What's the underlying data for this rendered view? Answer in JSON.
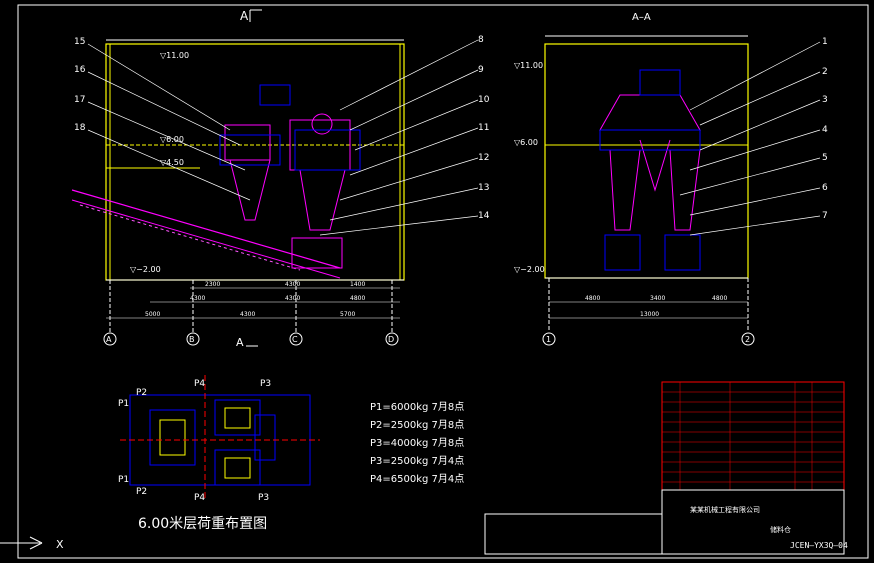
{
  "views": {
    "left_section_mark": "A",
    "left_section_mark_bottom": "A",
    "right_title": "A–A"
  },
  "elevations": {
    "left_top": "▽11.00",
    "left_mid1": "▽6.00",
    "left_mid2": "▽4.50",
    "left_bottom": "▽−2.00",
    "right_top": "▽11.00",
    "right_mid": "▽6.00",
    "right_bottom": "▽−2.00"
  },
  "left_callouts": [
    "15",
    "16",
    "17",
    "18"
  ],
  "center_callouts": [
    "8",
    "9",
    "10",
    "11",
    "12",
    "13",
    "14"
  ],
  "right_callouts": [
    "1",
    "2",
    "3",
    "4",
    "5",
    "6",
    "7"
  ],
  "left_dims": {
    "row1": [
      "2300",
      "4300",
      "1400"
    ],
    "row2": [
      "4300",
      "4300",
      "4800"
    ],
    "row3": [
      "5000",
      "4300",
      "5700"
    ]
  },
  "right_dims": {
    "row1": [
      "4800",
      "3400",
      "4800"
    ],
    "row2": "13000"
  },
  "left_axes": [
    "A",
    "B",
    "C",
    "D"
  ],
  "right_axes": [
    "1",
    "2"
  ],
  "load_plan": {
    "title": "6.00米层荷重布置图",
    "labels": {
      "p1a": "P1",
      "p2a": "P2",
      "p4a": "P4",
      "p3a": "P3",
      "p1b": "P1",
      "p2b": "P2",
      "p4b": "P4",
      "p3b": "P3"
    },
    "legend": [
      "P1=6000kg  7月8点",
      "P2=2500kg  7月8点",
      "P3=4000kg  7月8点",
      "P3=2500kg  7月4点",
      "P4=6500kg  7月4点"
    ]
  },
  "title_block": {
    "drawing_no": "JCEN–YX3Q–04",
    "company": "某某机械工程有限公司",
    "title": "储料仓"
  },
  "axis_indicator": "X"
}
